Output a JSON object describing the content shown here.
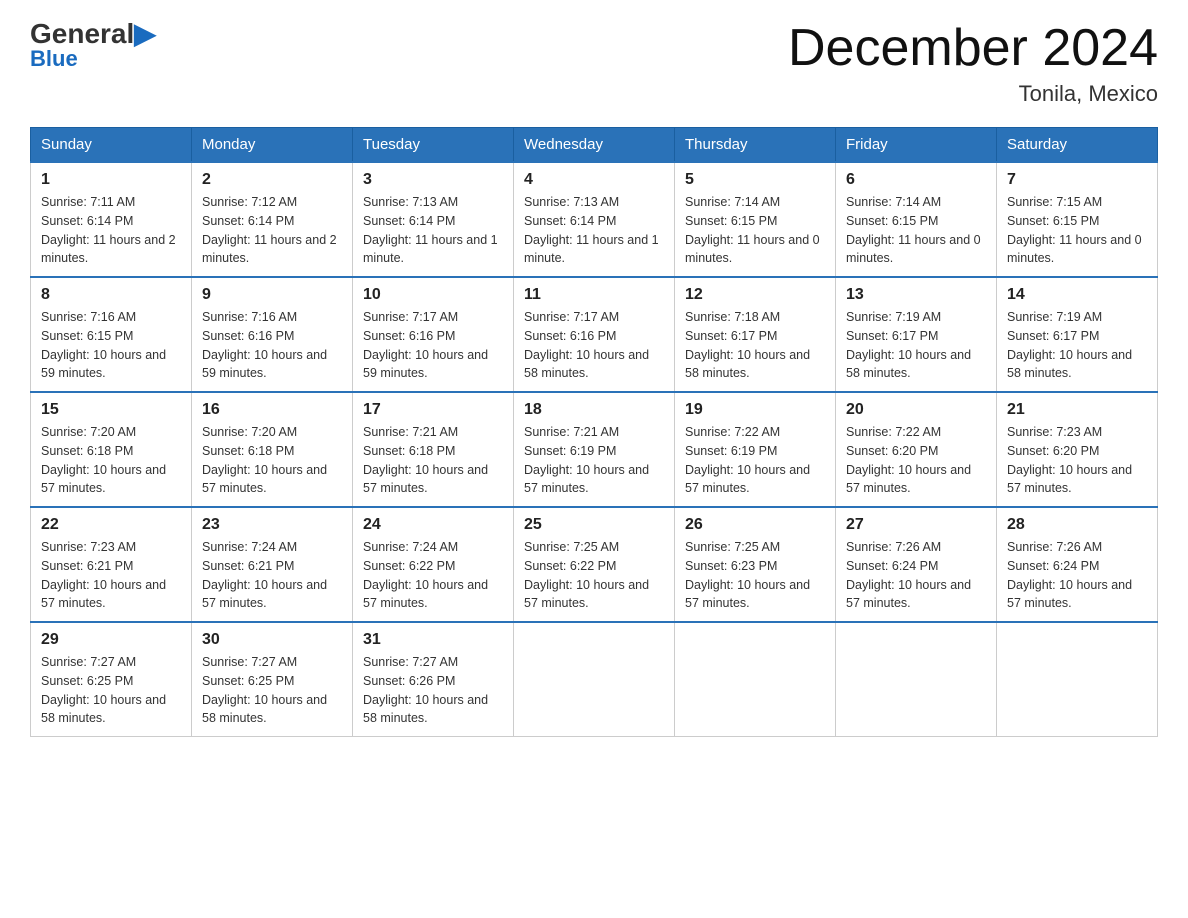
{
  "header": {
    "logo_general": "General",
    "logo_blue": "Blue",
    "title": "December 2024",
    "subtitle": "Tonila, Mexico"
  },
  "days_of_week": [
    "Sunday",
    "Monday",
    "Tuesday",
    "Wednesday",
    "Thursday",
    "Friday",
    "Saturday"
  ],
  "weeks": [
    [
      {
        "day": "1",
        "sunrise": "7:11 AM",
        "sunset": "6:14 PM",
        "daylight": "11 hours and 2 minutes."
      },
      {
        "day": "2",
        "sunrise": "7:12 AM",
        "sunset": "6:14 PM",
        "daylight": "11 hours and 2 minutes."
      },
      {
        "day": "3",
        "sunrise": "7:13 AM",
        "sunset": "6:14 PM",
        "daylight": "11 hours and 1 minute."
      },
      {
        "day": "4",
        "sunrise": "7:13 AM",
        "sunset": "6:14 PM",
        "daylight": "11 hours and 1 minute."
      },
      {
        "day": "5",
        "sunrise": "7:14 AM",
        "sunset": "6:15 PM",
        "daylight": "11 hours and 0 minutes."
      },
      {
        "day": "6",
        "sunrise": "7:14 AM",
        "sunset": "6:15 PM",
        "daylight": "11 hours and 0 minutes."
      },
      {
        "day": "7",
        "sunrise": "7:15 AM",
        "sunset": "6:15 PM",
        "daylight": "11 hours and 0 minutes."
      }
    ],
    [
      {
        "day": "8",
        "sunrise": "7:16 AM",
        "sunset": "6:15 PM",
        "daylight": "10 hours and 59 minutes."
      },
      {
        "day": "9",
        "sunrise": "7:16 AM",
        "sunset": "6:16 PM",
        "daylight": "10 hours and 59 minutes."
      },
      {
        "day": "10",
        "sunrise": "7:17 AM",
        "sunset": "6:16 PM",
        "daylight": "10 hours and 59 minutes."
      },
      {
        "day": "11",
        "sunrise": "7:17 AM",
        "sunset": "6:16 PM",
        "daylight": "10 hours and 58 minutes."
      },
      {
        "day": "12",
        "sunrise": "7:18 AM",
        "sunset": "6:17 PM",
        "daylight": "10 hours and 58 minutes."
      },
      {
        "day": "13",
        "sunrise": "7:19 AM",
        "sunset": "6:17 PM",
        "daylight": "10 hours and 58 minutes."
      },
      {
        "day": "14",
        "sunrise": "7:19 AM",
        "sunset": "6:17 PM",
        "daylight": "10 hours and 58 minutes."
      }
    ],
    [
      {
        "day": "15",
        "sunrise": "7:20 AM",
        "sunset": "6:18 PM",
        "daylight": "10 hours and 57 minutes."
      },
      {
        "day": "16",
        "sunrise": "7:20 AM",
        "sunset": "6:18 PM",
        "daylight": "10 hours and 57 minutes."
      },
      {
        "day": "17",
        "sunrise": "7:21 AM",
        "sunset": "6:18 PM",
        "daylight": "10 hours and 57 minutes."
      },
      {
        "day": "18",
        "sunrise": "7:21 AM",
        "sunset": "6:19 PM",
        "daylight": "10 hours and 57 minutes."
      },
      {
        "day": "19",
        "sunrise": "7:22 AM",
        "sunset": "6:19 PM",
        "daylight": "10 hours and 57 minutes."
      },
      {
        "day": "20",
        "sunrise": "7:22 AM",
        "sunset": "6:20 PM",
        "daylight": "10 hours and 57 minutes."
      },
      {
        "day": "21",
        "sunrise": "7:23 AM",
        "sunset": "6:20 PM",
        "daylight": "10 hours and 57 minutes."
      }
    ],
    [
      {
        "day": "22",
        "sunrise": "7:23 AM",
        "sunset": "6:21 PM",
        "daylight": "10 hours and 57 minutes."
      },
      {
        "day": "23",
        "sunrise": "7:24 AM",
        "sunset": "6:21 PM",
        "daylight": "10 hours and 57 minutes."
      },
      {
        "day": "24",
        "sunrise": "7:24 AM",
        "sunset": "6:22 PM",
        "daylight": "10 hours and 57 minutes."
      },
      {
        "day": "25",
        "sunrise": "7:25 AM",
        "sunset": "6:22 PM",
        "daylight": "10 hours and 57 minutes."
      },
      {
        "day": "26",
        "sunrise": "7:25 AM",
        "sunset": "6:23 PM",
        "daylight": "10 hours and 57 minutes."
      },
      {
        "day": "27",
        "sunrise": "7:26 AM",
        "sunset": "6:24 PM",
        "daylight": "10 hours and 57 minutes."
      },
      {
        "day": "28",
        "sunrise": "7:26 AM",
        "sunset": "6:24 PM",
        "daylight": "10 hours and 57 minutes."
      }
    ],
    [
      {
        "day": "29",
        "sunrise": "7:27 AM",
        "sunset": "6:25 PM",
        "daylight": "10 hours and 58 minutes."
      },
      {
        "day": "30",
        "sunrise": "7:27 AM",
        "sunset": "6:25 PM",
        "daylight": "10 hours and 58 minutes."
      },
      {
        "day": "31",
        "sunrise": "7:27 AM",
        "sunset": "6:26 PM",
        "daylight": "10 hours and 58 minutes."
      },
      null,
      null,
      null,
      null
    ]
  ]
}
